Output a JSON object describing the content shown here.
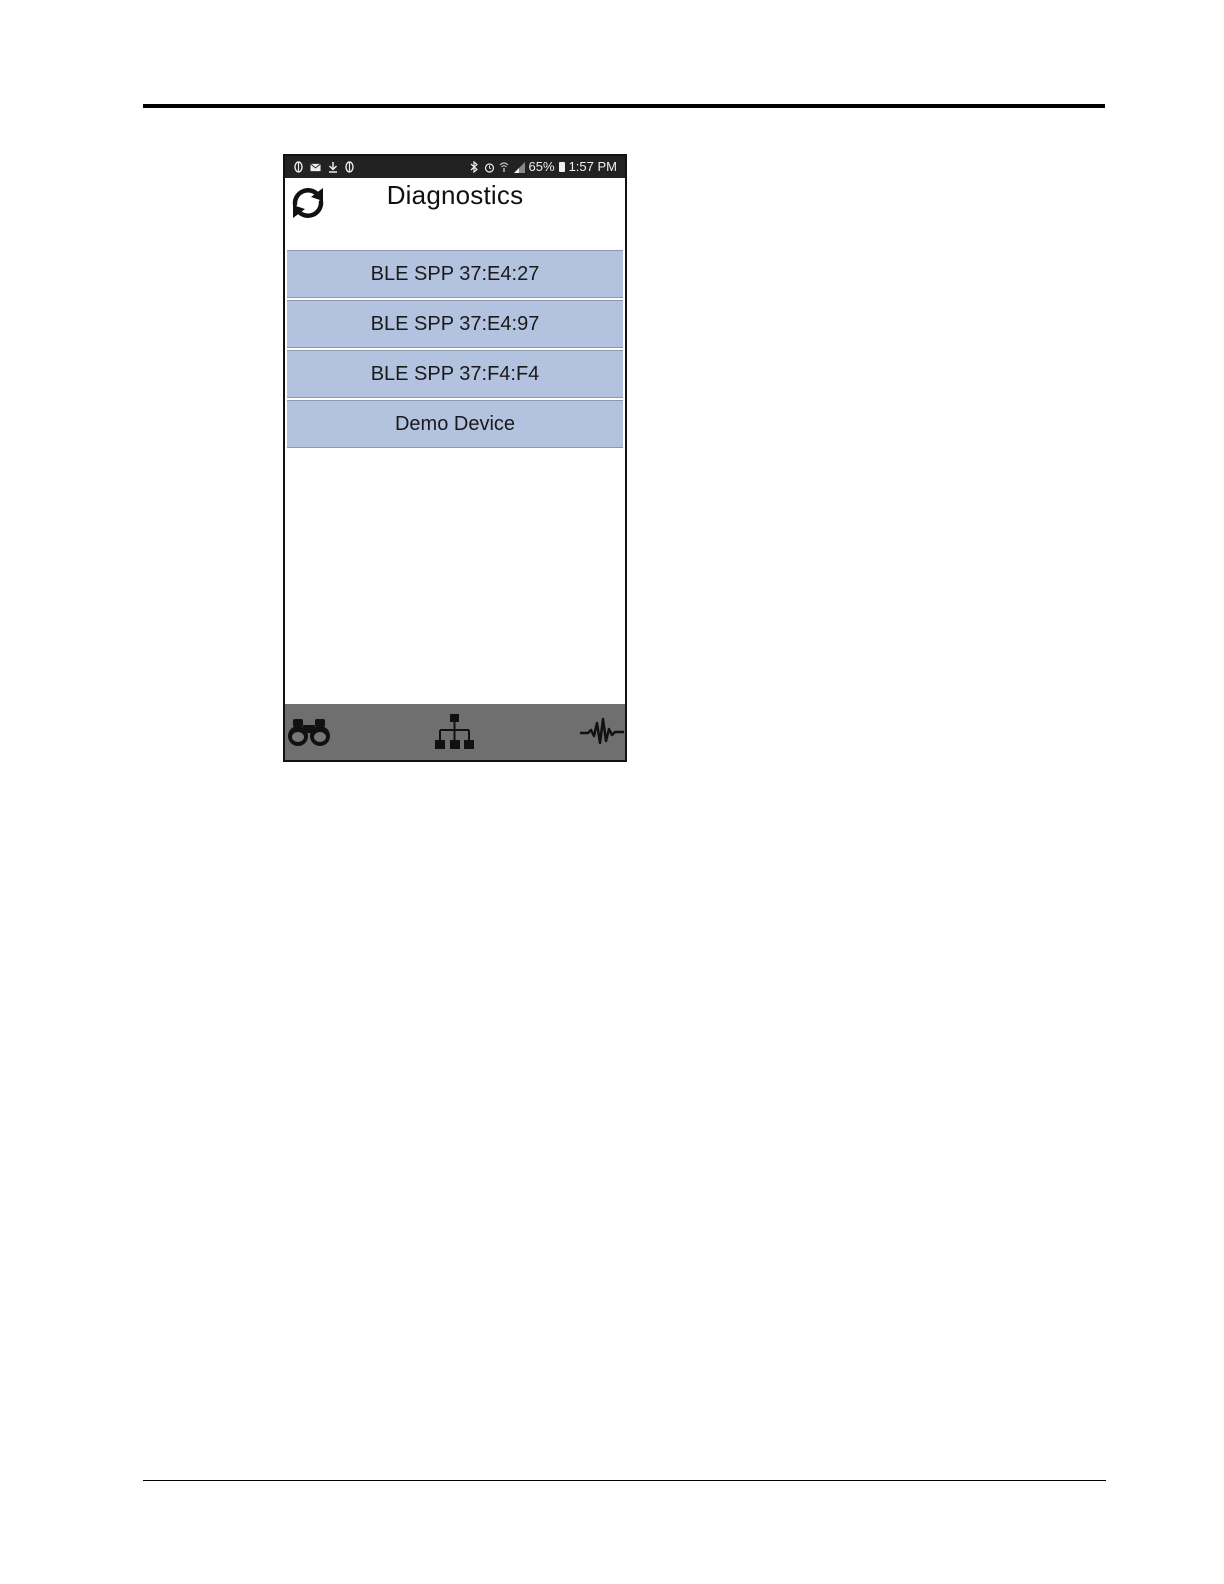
{
  "app": {
    "title": "Diagnostics"
  },
  "status_bar": {
    "left_icons": [
      "notification-icon",
      "mail-icon",
      "download-icon",
      "notification-icon"
    ],
    "right_icons": [
      "bluetooth-icon",
      "alarm-icon",
      "wifi-icon",
      "signal-icon"
    ],
    "battery": "65%",
    "time": "1:57 PM"
  },
  "devices": [
    {
      "label": "BLE SPP 37:E4:27"
    },
    {
      "label": "BLE SPP 37:E4:97"
    },
    {
      "label": "BLE SPP 37:F4:F4"
    },
    {
      "label": "Demo Device"
    }
  ],
  "bottom_nav": {
    "items": [
      "binoculars-icon",
      "hierarchy-icon",
      "waveform-icon"
    ]
  },
  "colors": {
    "list_item_bg": "#b3c3df",
    "status_bar_bg": "#222222",
    "bottom_nav_bg": "#6f6f6f"
  }
}
